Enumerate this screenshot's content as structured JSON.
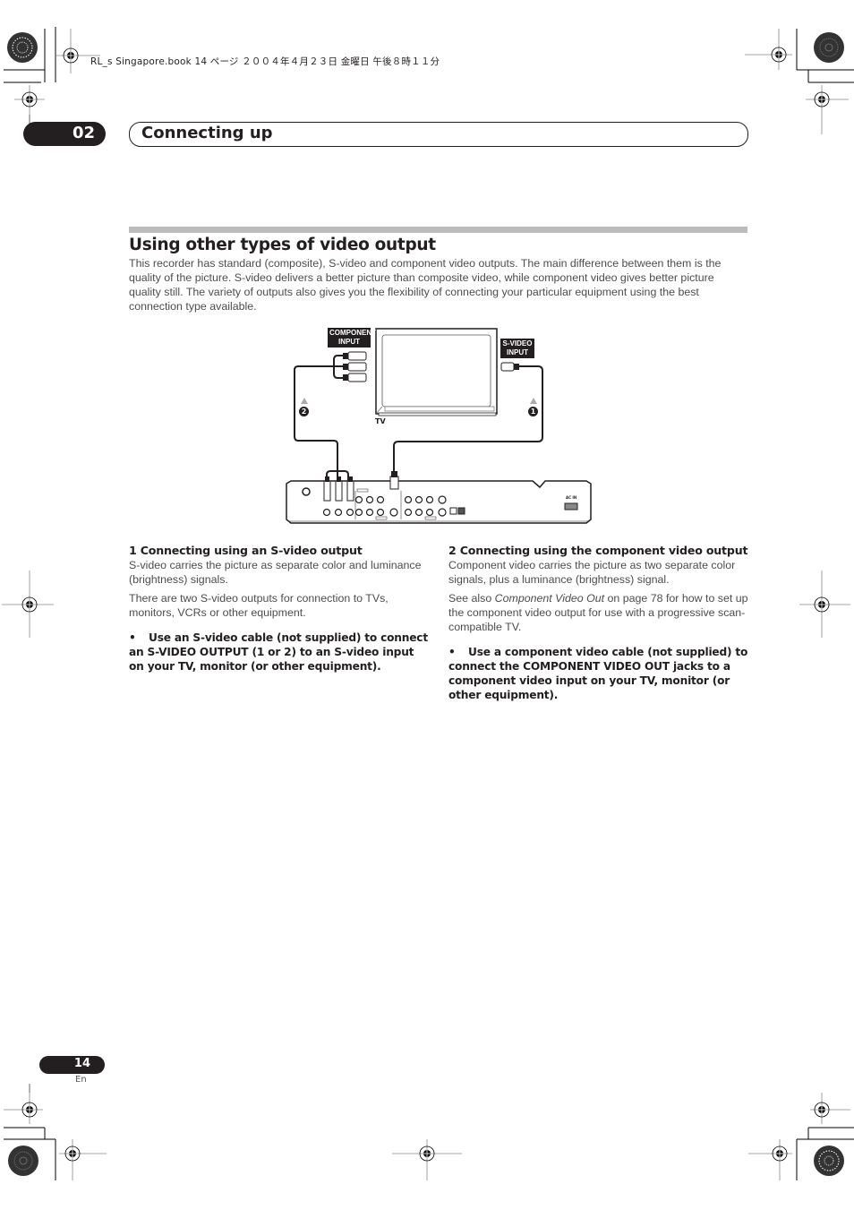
{
  "print_header": "RL_s Singapore.book 14 ページ ２００４年４月２３日 金曜日 午後８時１１分",
  "chapter": {
    "number": "02",
    "title": "Connecting up"
  },
  "section": {
    "title": "Using other types of video output",
    "intro": "This recorder has standard (composite), S-video and component video outputs. The main difference between them is the quality of the picture. S-video delivers a better picture than composite video, while component video gives better picture quality still. The variety of outputs also gives you the flexibility of connecting your particular equipment using the best connection type available."
  },
  "diagram": {
    "component_label_line1": "COMPONENT",
    "component_label_line2": "INPUT",
    "svideo_label_line1": "S-VIDEO",
    "svideo_label_line2": "INPUT",
    "tv_label": "TV",
    "callout_1": "1",
    "callout_2": "2",
    "recorder_ac_label": "AC IN"
  },
  "left_column": {
    "heading": "1  Connecting using an S-video output",
    "paragraphs": [
      "S-video carries the picture as separate color and luminance (brightness) signals.",
      "There are two S-video outputs for connection to TVs, monitors, VCRs or other equipment."
    ],
    "bullet_symbol": "•",
    "bullet": "Use an S-video cable (not supplied) to connect an S-VIDEO OUTPUT (1 or 2) to an S-video input on your TV, monitor (or other equipment)."
  },
  "right_column": {
    "heading": "2  Connecting using the component video output",
    "paragraphs": [
      "Component video carries the picture as two separate color signals, plus a luminance (brightness) signal."
    ],
    "see_also_prefix": "See also ",
    "see_also_ref": "Component Video Out",
    "see_also_suffix": " on page 78 for how to set up the component video output for use with a progressive scan-compatible TV.",
    "bullet_symbol": "•",
    "bullet": "Use a component video cable (not supplied) to connect the COMPONENT VIDEO OUT jacks to a component video input on your TV, monitor (or other equipment)."
  },
  "footer": {
    "page_number": "14",
    "language": "En"
  }
}
